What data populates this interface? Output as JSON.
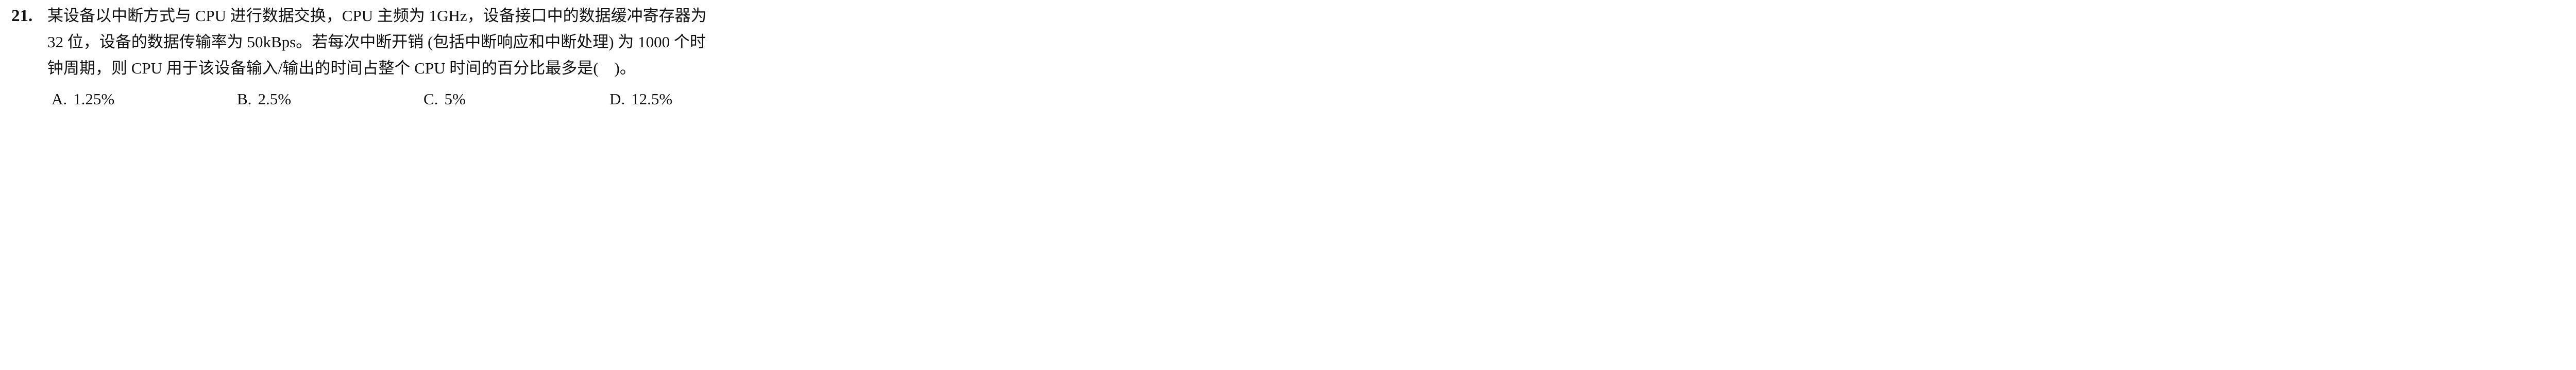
{
  "question": {
    "number": "21.",
    "lines": [
      "某设备以中断方式与 CPU 进行数据交换，CPU 主频为 1GHz，设备接口中的数据缓冲寄存器为",
      "32 位，设备的数据传输率为 50kBps。若每次中断开销 (包括中断响应和中断处理) 为 1000 个时",
      "钟周期，则 CPU 用于该设备输入/输出的时间占整个 CPU 时间的百分比最多是(　)。"
    ]
  },
  "options": [
    {
      "letter": "A.",
      "text": "1.25%"
    },
    {
      "letter": "B.",
      "text": "2.5%"
    },
    {
      "letter": "C.",
      "text": "5%"
    },
    {
      "letter": "D.",
      "text": "12.5%"
    }
  ]
}
